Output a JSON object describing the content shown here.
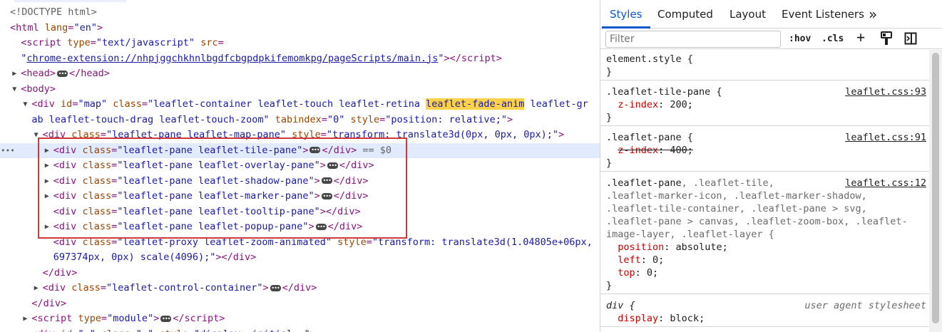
{
  "elements_panel": {
    "lines": [
      {
        "indent": 0,
        "html": "<span class='cm'>&lt;!DOCTYPE html&gt;</span>"
      },
      {
        "indent": 0,
        "html": "<span class='tag'>&lt;html</span> <span class='attr'>lang</span><span class='tag'>=</span><span class='val'>\"en\"</span><span class='tag'>&gt;</span>"
      },
      {
        "indent": 1,
        "html": "<span class='tag'>&lt;script</span> <span class='attr'>type</span><span class='tag'>=</span><span class='val'>\"text/javascript\"</span> <span class='attr'>src</span><span class='tag'>=</span>"
      },
      {
        "indent": 1,
        "html": "<span class='val'>\"</span><span class='link'>chrome-extension://nhpjggchkhnlbgdfcbgpdpkifemomkpg/pageScripts/main.js</span><span class='val'>\"</span><span class='tag'>&gt;&lt;/script&gt;</span>"
      },
      {
        "indent": 1,
        "tri": "▶",
        "html": "<span class='tag'>&lt;head&gt;</span><span class='ell'>•••</span><span class='tag'>&lt;/head&gt;</span>"
      },
      {
        "indent": 1,
        "tri": "▼",
        "html": "<span class='tag'>&lt;body&gt;</span>"
      },
      {
        "indent": 2,
        "tri": "▼",
        "html": "<span class='tag'>&lt;div</span> <span class='attr'>id</span><span class='tag'>=</span><span class='val'>\"map\"</span> <span class='attr'>class</span><span class='tag'>=</span><span class='val'>\"leaflet-container leaflet-touch leaflet-retina <span class='hl'>leaflet-fade-anim</span> leaflet-gr</span>"
      },
      {
        "indent": 2,
        "html": "<span class='val'>ab leaflet-touch-drag leaflet-touch-zoom\"</span> <span class='attr'>tabindex</span><span class='tag'>=</span><span class='val'>\"0\"</span> <span class='attr'>style</span><span class='tag'>=</span><span class='val'>\"position: relative;\"</span><span class='tag'>&gt;</span>"
      },
      {
        "indent": 3,
        "tri": "▼",
        "html": "<span class='tag'>&lt;div</span> <span class='attr'>class</span><span class='tag'>=</span><span class='val'>\"leaflet-pane leaflet-map-pane\"</span> <span class='attr'>style</span><span class='tag'>=</span><span class='val'>\"transform: translate3d(0px, 0px, 0px);\"</span><span class='tag'>&gt;</span>"
      },
      {
        "indent": 4,
        "tri": "▶",
        "selected": true,
        "html": "<span class='tag'>&lt;div</span> <span class='attr'>class</span><span class='tag'>=</span><span class='val'>\"leaflet-pane leaflet-tile-pane\"</span><span class='tag'>&gt;</span><span class='ell'>•••</span><span class='tag'>&lt;/div&gt;</span> <span class='cm'>== $0</span>"
      },
      {
        "indent": 4,
        "tri": "▶",
        "html": "<span class='tag'>&lt;div</span> <span class='attr'>class</span><span class='tag'>=</span><span class='val'>\"leaflet-pane leaflet-overlay-pane\"</span><span class='tag'>&gt;</span><span class='ell'>•••</span><span class='tag'>&lt;/div&gt;</span>"
      },
      {
        "indent": 4,
        "tri": "▶",
        "html": "<span class='tag'>&lt;div</span> <span class='attr'>class</span><span class='tag'>=</span><span class='val'>\"leaflet-pane leaflet-shadow-pane\"</span><span class='tag'>&gt;</span><span class='ell'>•••</span><span class='tag'>&lt;/div&gt;</span>"
      },
      {
        "indent": 4,
        "tri": "▶",
        "html": "<span class='tag'>&lt;div</span> <span class='attr'>class</span><span class='tag'>=</span><span class='val'>\"leaflet-pane leaflet-marker-pane\"</span><span class='tag'>&gt;</span><span class='ell'>•••</span><span class='tag'>&lt;/div&gt;</span>"
      },
      {
        "indent": 4,
        "html": "<span class='tag'>&lt;div</span> <span class='attr'>class</span><span class='tag'>=</span><span class='val'>\"leaflet-pane leaflet-tooltip-pane\"</span><span class='tag'>&gt;&lt;/div&gt;</span>"
      },
      {
        "indent": 4,
        "tri": "▶",
        "html": "<span class='tag'>&lt;div</span> <span class='attr'>class</span><span class='tag'>=</span><span class='val'>\"leaflet-pane leaflet-popup-pane\"</span><span class='tag'>&gt;</span><span class='ell'>•••</span><span class='tag'>&lt;/div&gt;</span>"
      },
      {
        "indent": 4,
        "html": "<span class='tag'>&lt;div</span> <span class='attr'>class</span><span class='tag'>=</span><span class='val'>\"leaflet-proxy leaflet-zoom-animated\"</span> <span class='attr'>style</span><span class='tag'>=</span><span class='val'>\"transform: translate3d(1.04805e+06px,</span>"
      },
      {
        "indent": 4,
        "html": "<span class='val'>697374px, 0px) scale(4096);\"</span><span class='tag'>&gt;&lt;/div&gt;</span>"
      },
      {
        "indent": 3,
        "html": "<span class='tag'>&lt;/div&gt;</span>"
      },
      {
        "indent": 3,
        "tri": "▶",
        "html": "<span class='tag'>&lt;div</span> <span class='attr'>class</span><span class='tag'>=</span><span class='val'>\"leaflet-control-container\"</span><span class='tag'>&gt;</span><span class='ell'>•••</span><span class='tag'>&lt;/div&gt;</span>"
      },
      {
        "indent": 2,
        "html": "<span class='tag'>&lt;/div&gt;</span>"
      },
      {
        "indent": 2,
        "tri": "▶",
        "html": "<span class='tag'>&lt;script</span> <span class='attr'>type</span><span class='tag'>=</span><span class='val'>\"module\"</span><span class='tag'>&gt;</span><span class='ell'>•••</span><span class='tag'>&lt;/script&gt;</span>"
      },
      {
        "indent": 2,
        "tri": "▶",
        "html": "<span class='tag'>&lt;div</span> <span class='attr'>id</span><span class='tag'>=</span><span class='val'>\"…\"</span> <span class='attr'>class</span><span class='tag'>=</span><span class='val'>\"…\"</span> <span class='attr'>style</span><span class='tag'>=</span><span class='val'>\"display: initial …\"</span><span class='tag'>&gt;</span>"
      }
    ],
    "gutter_marker": "•••"
  },
  "styles_panel": {
    "tabs": [
      "Styles",
      "Computed",
      "Layout",
      "Event Listeners"
    ],
    "more_tabs": "»",
    "filter_placeholder": "Filter",
    "hov_label": ":hov",
    "cls_label": ".cls",
    "add_rule": "+",
    "rules": [
      {
        "selector": "element.style {",
        "close": "}",
        "decls": []
      },
      {
        "selector": ".leaflet-tile-pane {",
        "source": "leaflet.css:93",
        "close": "}",
        "decls": [
          {
            "prop": "z-index",
            "value": "200;",
            "struck": false
          }
        ]
      },
      {
        "selector": ".leaflet-pane {",
        "source": "leaflet.css:91",
        "close": "}",
        "decls": [
          {
            "prop": "z-index",
            "value": "400;",
            "struck": true
          }
        ]
      },
      {
        "selector_html": "<span class='sel'>.leaflet-pane</span><span class='sel-dim'>, .leaflet-tile,</span>",
        "extra_selector_lines": [
          ".leaflet-marker-icon, .leaflet-marker-shadow,",
          ".leaflet-tile-container, .leaflet-pane > svg,",
          ".leaflet-pane > canvas, .leaflet-zoom-box, .leaflet-",
          "image-layer, .leaflet-layer {"
        ],
        "source": "leaflet.css:12",
        "close": "}",
        "decls": [
          {
            "prop": "position",
            "value": "absolute;",
            "struck": false
          },
          {
            "prop": "left",
            "value": "0;",
            "struck": false
          },
          {
            "prop": "top",
            "value": "0;",
            "struck": false
          }
        ]
      },
      {
        "selector_italic": "div {",
        "ua_source": "user agent stylesheet",
        "decls": [
          {
            "prop": "display",
            "value": "block;",
            "struck": false
          }
        ]
      }
    ]
  },
  "colors": {
    "accent": "#0b57d0",
    "selection": "#e2ebfd",
    "highlight": "#fcd24b",
    "red_box": "#d0393b"
  }
}
